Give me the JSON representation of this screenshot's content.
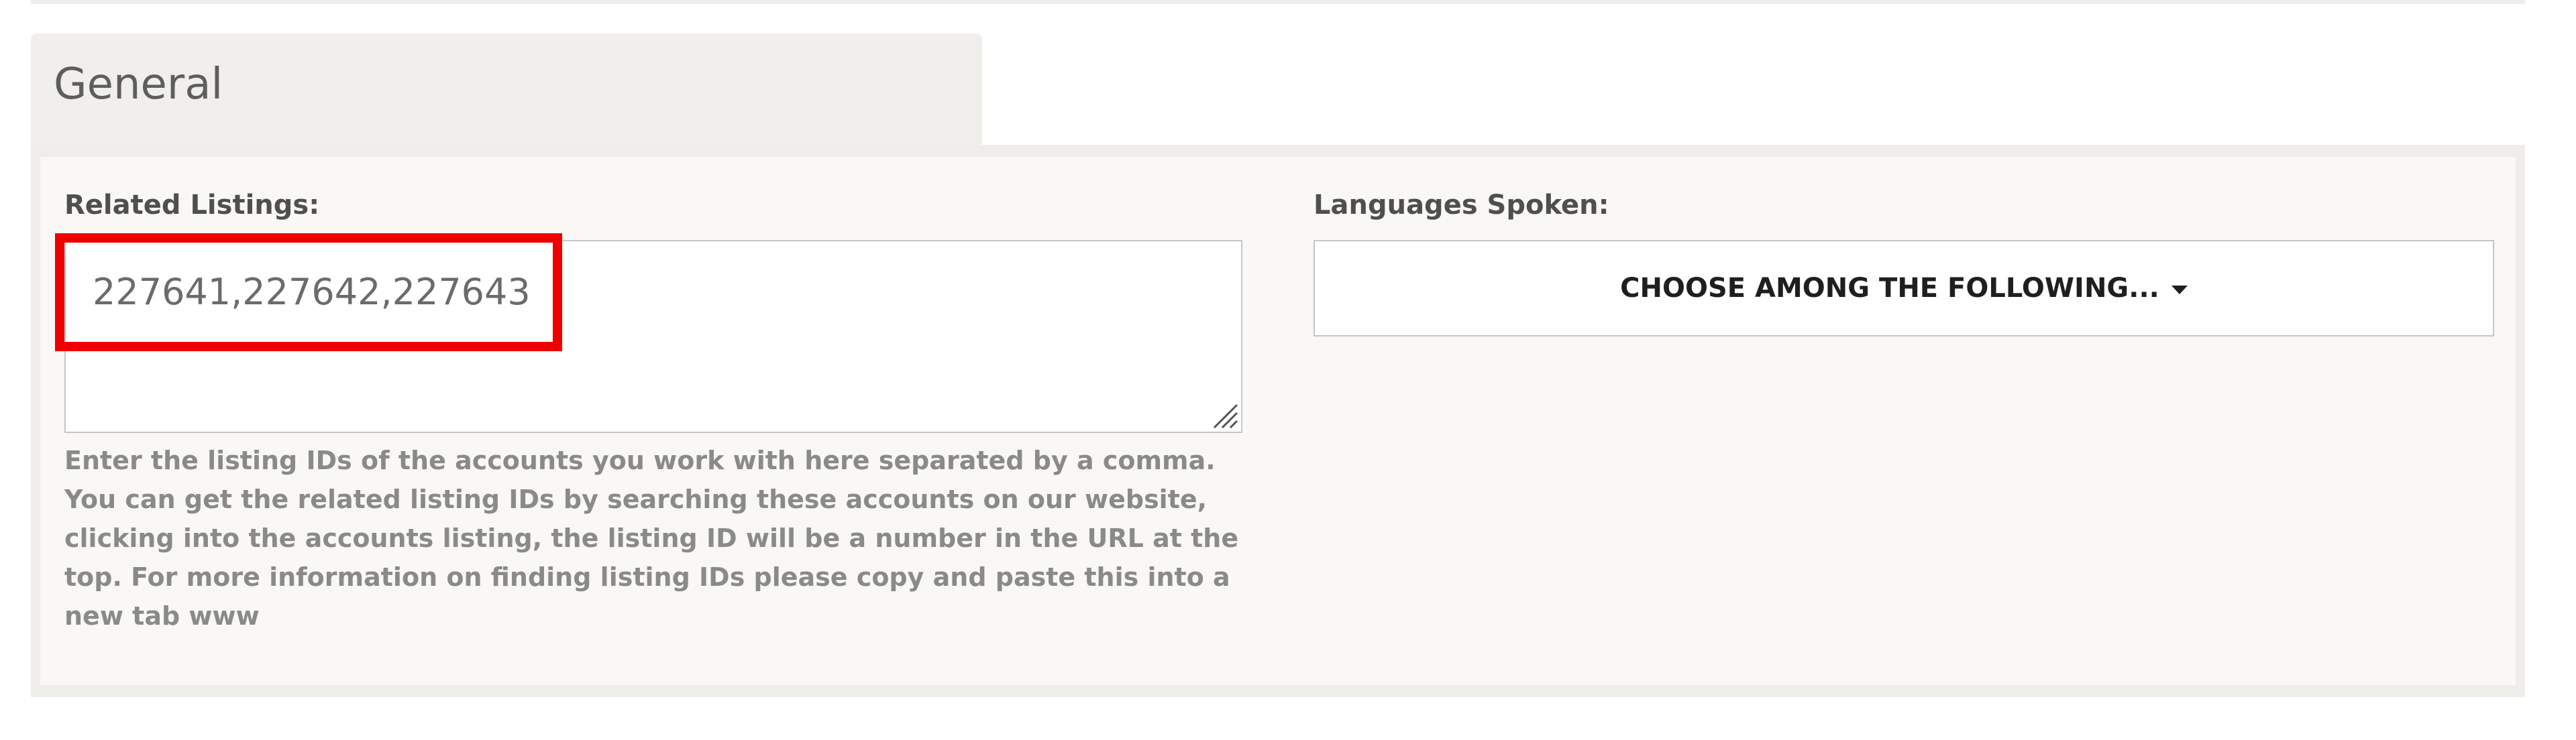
{
  "section": {
    "tab_title": "General"
  },
  "related_listings": {
    "label": "Related Listings:",
    "value": "227641,227642,227643",
    "help": "Enter the listing IDs of the accounts you work with here separated by a comma. You can get the related listing IDs by searching these accounts on our website, clicking into the accounts listing, the listing ID will be a number in the URL at the top. For more information on finding listing IDs please copy and paste this into a new tab www"
  },
  "languages": {
    "label": "Languages Spoken:",
    "dropdown_label": "CHOOSE AMONG THE FOLLOWING...",
    "dropdown_icon": "caret-down-icon"
  },
  "colors": {
    "highlight": "#ee0000",
    "panel_background": "#f9f8f5",
    "tab_background": "#f0efeb"
  }
}
